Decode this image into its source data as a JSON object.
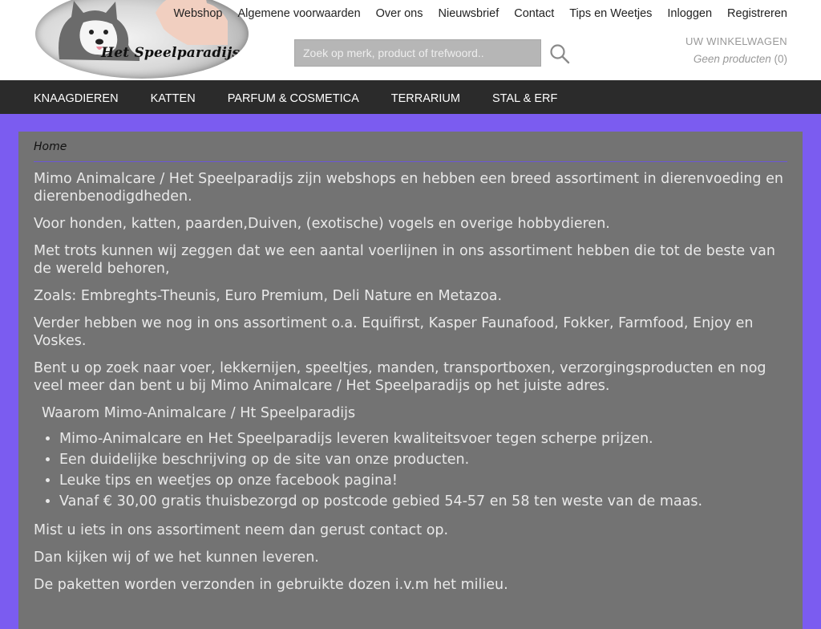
{
  "header": {
    "logo_text": "Het Speelparadijs",
    "top_nav": [
      "Webshop",
      "Algemene voorwaarden",
      "Over ons",
      "Nieuwsbrief",
      "Contact",
      "Tips en Weetjes",
      "Inloggen",
      "Registreren"
    ],
    "search": {
      "placeholder": "Zoek op merk, product of trefwoord..",
      "value": ""
    },
    "cart": {
      "title": "UW WINKELWAGEN",
      "status": "Geen producten",
      "count": "(0)"
    }
  },
  "main_nav": [
    "KNAAGDIEREN",
    "KATTEN",
    "PARFUM & COSMETICA",
    "TERRARIUM",
    "STAL & ERF"
  ],
  "content": {
    "breadcrumb": "Home",
    "paragraphs_top": [
      "Mimo Animalcare / Het Speelparadijs  zijn webshops en  hebben een breed assortiment in dierenvoeding en dierenbenodigdheden.",
      "Voor honden, katten, paarden,Duiven,  (exotische) vogels en overige hobbydieren.",
      "Met trots kunnen wij zeggen dat we een aantal voerlijnen in ons assortiment hebben die tot de beste van de wereld behoren,",
      "Zoals: Embreghts-Theunis, Euro Premium, Deli Nature en Metazoa.",
      "Verder hebben we nog in ons assortiment o.a. Equifirst, Kasper Faunafood, Fokker, Farmfood, Enjoy en Voskes.",
      "Bent u op zoek naar voer, lekkernijen, speeltjes, manden, transportboxen, verzorgingsproducten  en nog veel meer dan bent u bij Mimo Animalcare / Het Speelparadijs op het juiste adres."
    ],
    "why_heading": "Waarom Mimo-Animalcare / Ht Speelparadijs",
    "bullets": [
      " Mimo-Animalcare en Het Speelparadijs leveren kwaliteitsvoer tegen scherpe prijzen.",
      "Een duidelijke beschrijving op de site van onze producten.",
      "Leuke tips en weetjes op onze facebook pagina!",
      "Vanaf  € 30,00 gratis thuisbezorgd op postcode gebied 54-57 en 58 ten weste van de maas."
    ],
    "paragraphs_bottom": [
      "Mist u iets in ons assortiment neem dan gerust contact op.",
      "Dan kijken wij of we het kunnen leveren.",
      "De paketten worden verzonden in gebruikte dozen i.v.m het milieu."
    ]
  },
  "colors": {
    "page_bg": "#7b5cf0",
    "nav_bg": "#2b2b2b",
    "content_bg": "#737373",
    "text": "#e9e9e9"
  }
}
